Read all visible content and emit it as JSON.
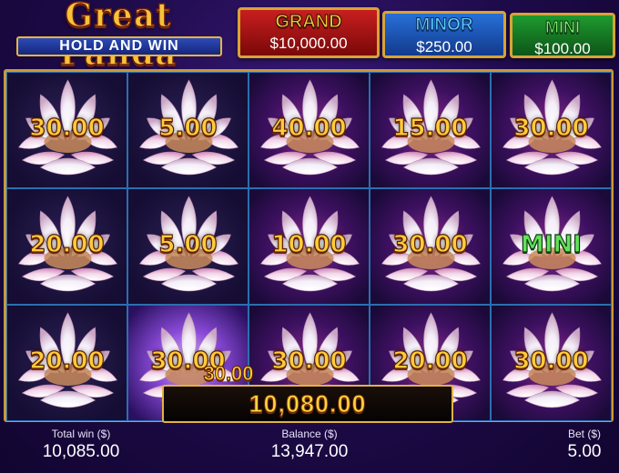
{
  "logo": {
    "title": "Great Panda",
    "subtitle": "HOLD AND WIN"
  },
  "jackpots": {
    "grand": {
      "name": "GRAND",
      "value": "$10,000.00"
    },
    "minor": {
      "name": "MINOR",
      "value": "$250.00"
    },
    "mini": {
      "name": "MINI",
      "value": "$100.00"
    }
  },
  "grid": {
    "cells": [
      "30.00",
      "5.00",
      "40.00",
      "15.00",
      "30.00",
      "20.00",
      "5.00",
      "10.00",
      "30.00",
      "MINI",
      "20.00",
      "30.00",
      "30.00",
      "20.00",
      "30.00"
    ]
  },
  "win": {
    "line_win": "30.00",
    "total": "10,080.00"
  },
  "footer": {
    "total_win_label": "Total win ($)",
    "total_win": "10,085.00",
    "balance_label": "Balance ($)",
    "balance": "13,947.00",
    "bet_label": "Bet ($)",
    "bet": "5.00"
  },
  "icons": {
    "symbol": "lotus-icon"
  }
}
